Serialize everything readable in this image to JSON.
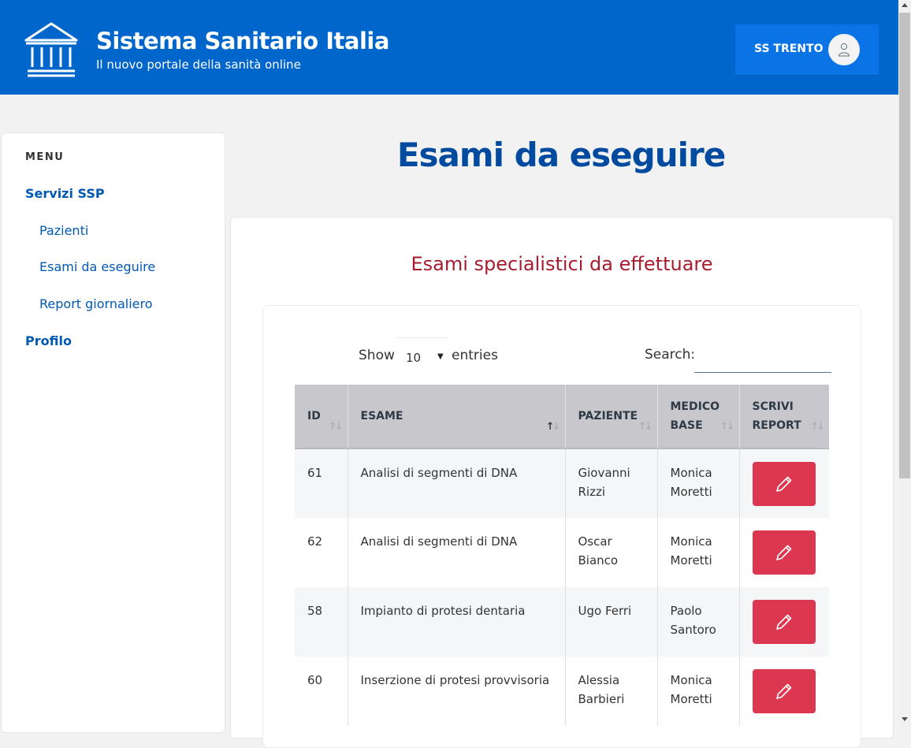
{
  "header": {
    "title": "Sistema Sanitario Italia",
    "subtitle": "Il nuovo portale della sanità online",
    "user_label": "SS TRENTO",
    "logo_icon": "institution-icon",
    "avatar_icon": "user-icon",
    "bg_color": "#0066cc"
  },
  "sidebar": {
    "menu_label": "MENU",
    "items": [
      {
        "label": "Servizi SSP",
        "bold": true
      },
      {
        "label": "Pazienti",
        "bold": false
      },
      {
        "label": "Esami da eseguire",
        "bold": false
      },
      {
        "label": "Report giornaliero",
        "bold": false
      },
      {
        "label": "Profilo",
        "bold": true
      }
    ]
  },
  "page_title": "Esami da eseguire",
  "section_title": "Esami specialistici da effettuare",
  "controls": {
    "show_label": "Show",
    "entries_value": "10",
    "entries_label": "entries",
    "search_label": "Search:",
    "search_value": ""
  },
  "table": {
    "headers": [
      {
        "line1": "ID",
        "line2": ""
      },
      {
        "line1": "ESAME",
        "line2": ""
      },
      {
        "line1": "PAZIENTE",
        "line2": ""
      },
      {
        "line1": "MEDICO",
        "line2": "BASE"
      },
      {
        "line1": "SCRIVI",
        "line2": "REPORT"
      }
    ],
    "sorted_column": "ESAME",
    "rows": [
      {
        "id": "61",
        "esame": "Analisi di segmenti di DNA",
        "paziente_1": "Giovanni",
        "paziente_2": "Rizzi",
        "medico_1": "Monica",
        "medico_2": "Moretti"
      },
      {
        "id": "62",
        "esame": "Analisi di segmenti di DNA",
        "paziente_1": "Oscar",
        "paziente_2": "Bianco",
        "medico_1": "Monica",
        "medico_2": "Moretti"
      },
      {
        "id": "58",
        "esame": "Impianto di protesi dentaria",
        "paziente_1": "Ugo Ferri",
        "paziente_2": "",
        "medico_1": "Paolo",
        "medico_2": "Santoro"
      },
      {
        "id": "60",
        "esame": "Inserzione di protesi provvisoria",
        "paziente_1": "Alessia",
        "paziente_2": "Barbieri",
        "medico_1": "Monica",
        "medico_2": "Moretti"
      }
    ],
    "action_icon": "pencil-icon",
    "action_color": "#dc3750"
  }
}
